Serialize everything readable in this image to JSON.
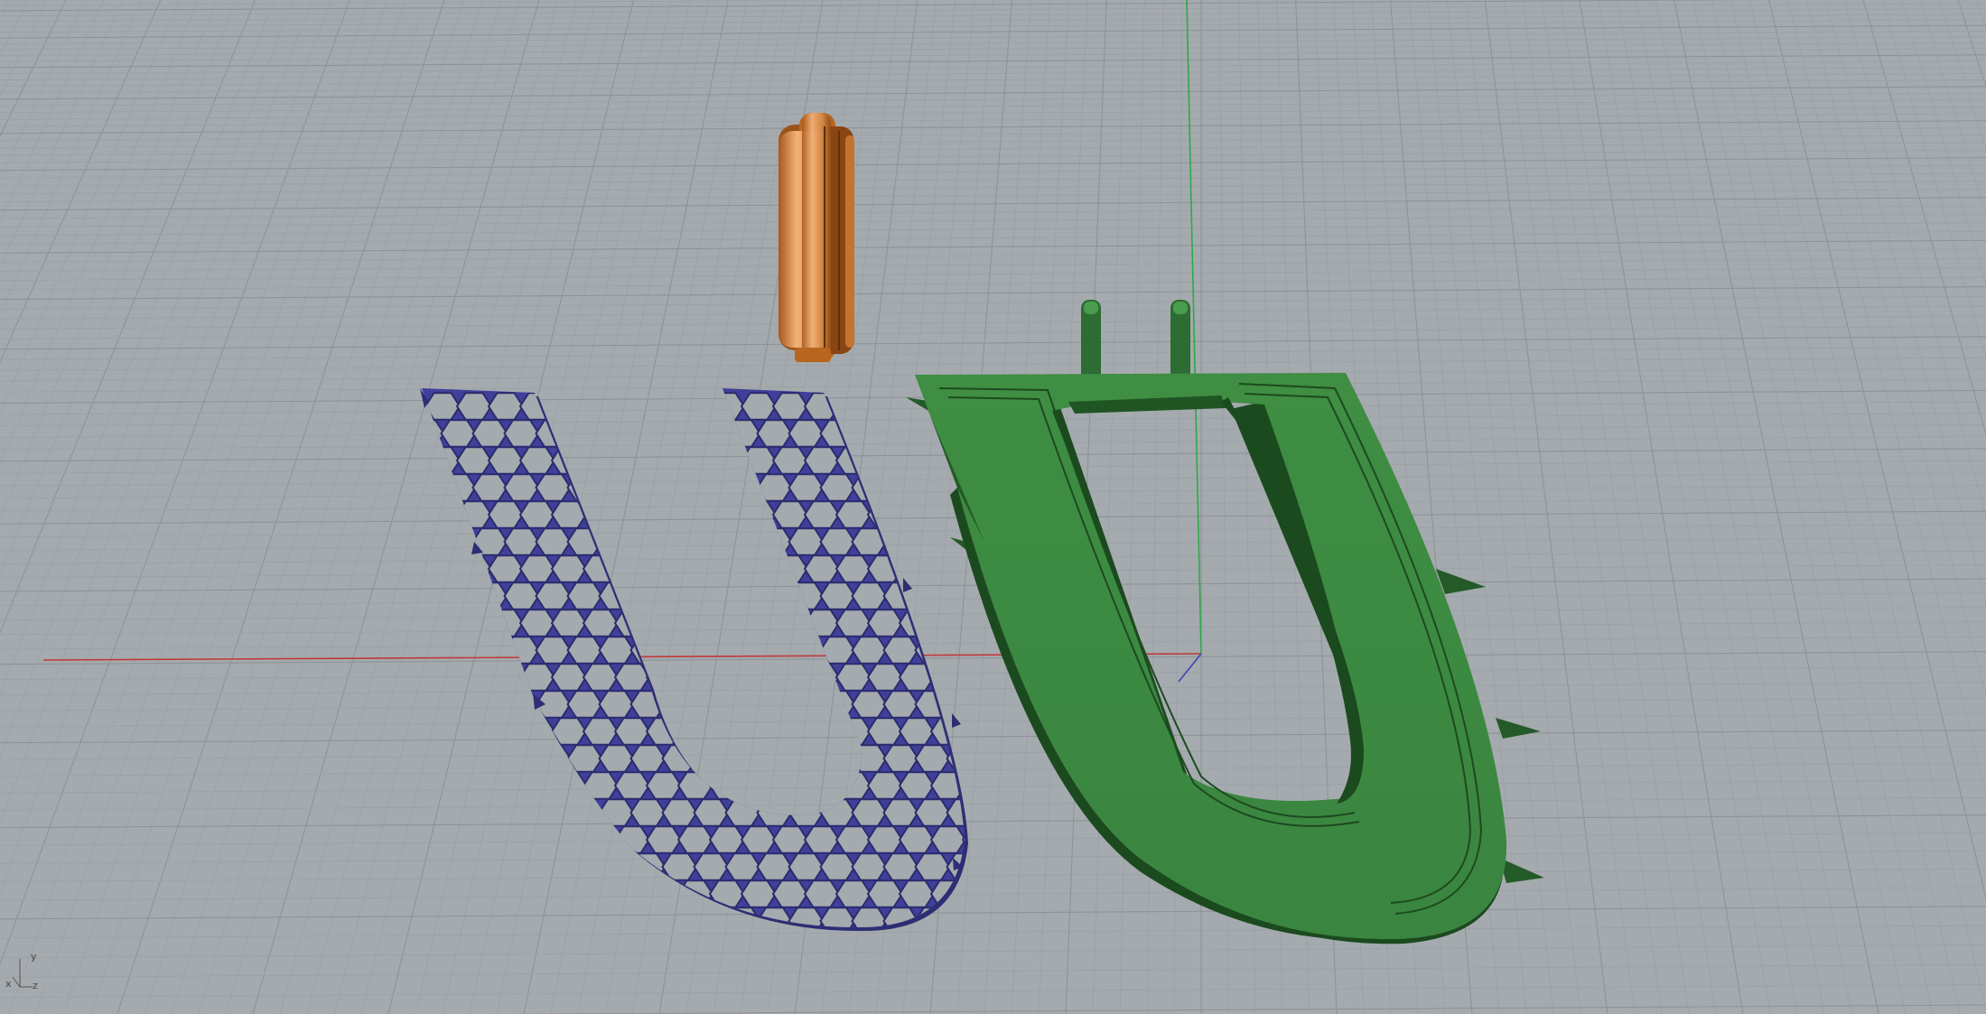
{
  "viewport": {
    "background": "#a5aaae",
    "grid_minor_color": "#9a9fa3",
    "grid_major_color": "#8e9397",
    "x_axis_color": "#c0393b",
    "y_axis_color": "#2fa84a",
    "z_axis_color": "#3b45b8"
  },
  "objects": [
    {
      "name": "honeycomb-u-frame",
      "color": "#3f3f96"
    },
    {
      "name": "ring-band",
      "color": "#e1964f"
    },
    {
      "name": "solid-u-frame",
      "color": "#3d8a41"
    }
  ],
  "axis_indicator": {
    "x_label": "x",
    "y_label": "y",
    "z_label": "z"
  }
}
